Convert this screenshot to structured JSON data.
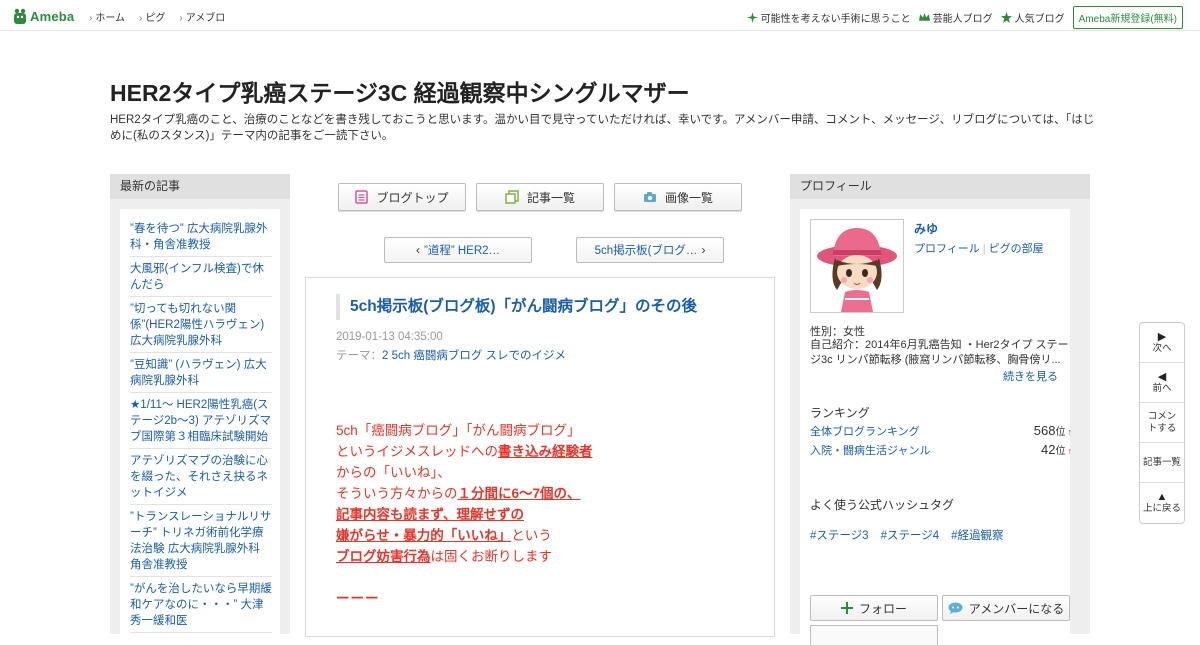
{
  "topbar": {
    "logo_text": "Ameba",
    "nav": [
      "ホーム",
      "ピグ",
      "アメブロ"
    ],
    "right_items": [
      {
        "label": "可能性を考えない手術に思うこと",
        "icon": "sparkle-icon"
      },
      {
        "label": "芸能人ブログ",
        "icon": "crown-icon"
      },
      {
        "label": "人気ブログ",
        "icon": "star-icon"
      }
    ],
    "register_label": "Ameba新規登録(無料)"
  },
  "header": {
    "title": "HER2タイプ乳癌ステージ3C 経過観察中シングルマザー",
    "description": "HER2タイプ乳癌のこと、治療のことなどを書き残しておこうと思います。温かい目で見守っていただければ、幸いです。アメンバー申請、コメント、メッセージ、リブログについては、「はじめに(私のスタンス)」テーマ内の記事をご一読下さい。"
  },
  "left_sidebar": {
    "heading": "最新の記事",
    "items": [
      "”春を待つ” 広大病院乳腺外科・角舎准教授",
      "大風邪(インフル検査)で休んだら",
      "”切っても切れない関係”(HER2陽性ハラヴェン) 広大病院乳腺外科",
      "”豆知識” (ハラヴェン) 広大病院乳腺外科",
      "★1/11～ HER2陽性乳癌(ステージ2b～3) アテゾリズマブ国際第３相臨床試験開始",
      "アテゾリズマブの治験に心を綴った、それさえ抉るネットイジメ",
      "”トランスレーショナルリサーチ” トリネガ術前化学療法治験 広大病院乳腺外科 角舎准教授",
      "”がんを治したいなら早期緩和ケアなのに・・・” 大津秀一緩和医"
    ]
  },
  "center": {
    "tabs": [
      {
        "label": "ブログトップ",
        "icon": "document-icon"
      },
      {
        "label": "記事一覧",
        "icon": "copy-icon"
      },
      {
        "label": "画像一覧",
        "icon": "camera-icon"
      }
    ],
    "prev_label": "”道程” HER2…",
    "next_label": "5ch掲示板(ブログ…",
    "article": {
      "title": "5ch掲示板(ブログ板)「がん闘病ブログ」のその後",
      "date": "2019-01-13 04:35:00",
      "theme_label": "テーマ：",
      "theme_value": "2 5ch 癌闘病ブログ スレでのイジメ",
      "body": {
        "l1": "5ch「癌闘病ブログ」「がん闘病ブログ」",
        "l2a": "というイジメスレッドへの",
        "l2b": "書き込み経験者",
        "l3": "からの「いいね」、",
        "l4a": "そういう方々からの",
        "l4b": "１分間に6～7個の、",
        "l5": "記事内容も読まず、理解せずの",
        "l6a": "嫌がらせ・暴力的「いいね」",
        "l6b": "という",
        "l7a": "ブログ妨害行為",
        "l7b": "は固くお断りします",
        "l8": "ーーー"
      }
    }
  },
  "right_sidebar": {
    "heading": "プロフィール",
    "name": "みゆ",
    "link_profile": "プロフィール",
    "link_pig": "ピグの部屋",
    "gender": "性別：女性",
    "intro": "自己紹介：2014年6月乳癌告知 ・Her2タイプ ステージ3c リンパ節転移 (腋窩リンパ節転移、胸骨傍リ...",
    "more": "続きを見る",
    "ranking_heading": "ランキング",
    "rankings": [
      {
        "label": "全体ブログランキング",
        "value": "568",
        "unit": "位",
        "trend": "↑"
      },
      {
        "label": "入院・闘病生活ジャンル",
        "value": "42",
        "unit": "位",
        "trend": "↑"
      }
    ],
    "hashtag_heading": "よく使う公式ハッシュタグ",
    "hashtags": [
      "#ステージ3",
      "#ステージ4",
      "#経過観察"
    ],
    "follow_label": "フォロー",
    "member_label": "アメンバーになる"
  },
  "sidenav": [
    {
      "glyph": "▶",
      "label": "次へ",
      "icon": "next-icon"
    },
    {
      "glyph": "◀",
      "label": "前へ",
      "icon": "prev-icon"
    },
    {
      "glyph": "",
      "label": "コメントする",
      "icon": ""
    },
    {
      "glyph": "",
      "label": "記事一覧",
      "icon": ""
    },
    {
      "glyph": "▲",
      "label": "上に戻る",
      "icon": "up-icon"
    }
  ],
  "colors": {
    "link": "#1a5eab",
    "accent": "#2d8c3c",
    "article_text": "#e8352a"
  }
}
